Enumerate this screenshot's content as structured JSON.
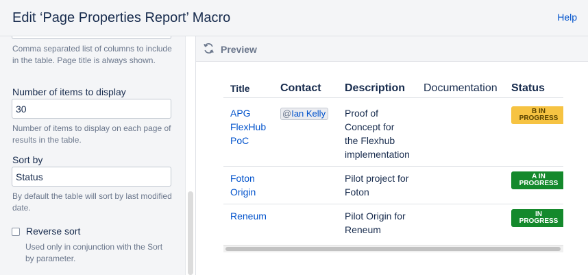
{
  "dialog": {
    "title": "Edit ‘Page Properties Report’ Macro",
    "help_label": "Help"
  },
  "form": {
    "columns_help": "Comma separated list of columns to include in the table. Page title is always shown.",
    "items_label": "Number of items to display",
    "items_value": "30",
    "items_help": "Number of items to display on each page of results in the table.",
    "sort_label": "Sort by",
    "sort_value": "Status",
    "sort_help": "By default the table will sort by last modified date.",
    "reverse_label": "Reverse sort",
    "reverse_checked": false,
    "reverse_help": "Used only in conjunction with the Sort by parameter."
  },
  "preview": {
    "label": "Preview",
    "icon": "refresh-icon",
    "table": {
      "headers": [
        "Title",
        "Contact",
        "Description",
        "Documentation",
        "Status"
      ],
      "rows": [
        {
          "title_lines": [
            "APG",
            "FlexHub",
            "PoC"
          ],
          "contact": "Ian Kelly",
          "description_lines": [
            "Proof of",
            "Concept for",
            "the Flexhub",
            "implementation"
          ],
          "documentation": "",
          "status_lines": [
            "B IN",
            "PROGRESS"
          ],
          "status_color": "#f6c342"
        },
        {
          "title_lines": [
            "Foton",
            "Origin"
          ],
          "contact": "",
          "description_lines": [
            "Pilot project for",
            "Foton"
          ],
          "documentation": "",
          "status_lines": [
            "A IN",
            "PROGRESS"
          ],
          "status_color": "#14892c"
        },
        {
          "title_lines": [
            "Reneum"
          ],
          "contact": "",
          "description_lines": [
            "Pilot Origin for",
            "Reneum"
          ],
          "documentation": "",
          "status_lines": [
            "IN",
            "PROGRESS"
          ],
          "status_color": "#14892c"
        }
      ]
    }
  },
  "colors": {
    "link": "#0052cc",
    "panel_bg": "#f4f5f7",
    "text": "#172b4d",
    "muted": "#6b778c"
  }
}
